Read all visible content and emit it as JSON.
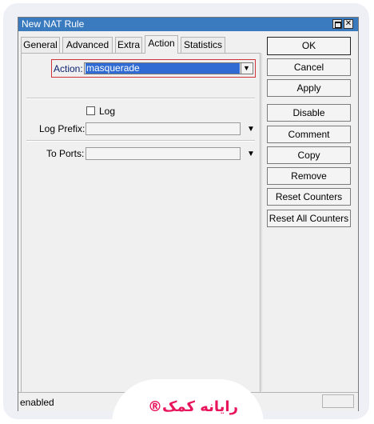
{
  "window": {
    "title": "New NAT Rule",
    "close_glyph": "✕"
  },
  "tabs": [
    {
      "label": "General"
    },
    {
      "label": "Advanced"
    },
    {
      "label": "Extra"
    },
    {
      "label": "Action",
      "active": true
    },
    {
      "label": "Statistics"
    }
  ],
  "form": {
    "action_label": "Action:",
    "action_value": "masquerade",
    "log_label": "Log",
    "log_checked": false,
    "log_prefix_label": "Log Prefix:",
    "log_prefix_value": "",
    "to_ports_label": "To Ports:",
    "to_ports_value": "",
    "dropdown_glyph": "▼"
  },
  "buttons": {
    "ok": "OK",
    "cancel": "Cancel",
    "apply": "Apply",
    "disable": "Disable",
    "comment": "Comment",
    "copy": "Copy",
    "remove": "Remove",
    "reset_counters": "Reset Counters",
    "reset_all_counters": "Reset All Counters"
  },
  "status": {
    "text": "enabled"
  },
  "watermark": {
    "text": "رایانه کمک®"
  },
  "colors": {
    "titlebar": "#3a7bbf",
    "selection": "#2f6bd3",
    "highlight_border": "#d0343a",
    "watermark": "#e8145c"
  }
}
